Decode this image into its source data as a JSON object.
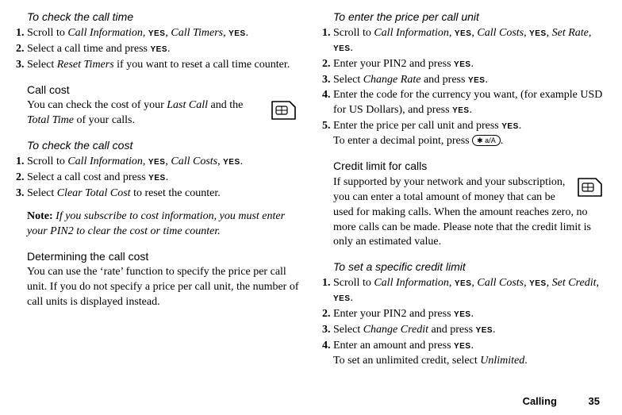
{
  "yes": "YES",
  "left": {
    "h_check_time": "To check the call time",
    "time_steps": [
      {
        "pre": "Scroll to ",
        "i1": "Call Information",
        "mid1": ", ",
        "y1": true,
        "mid2": ", ",
        "i2": "Call Timers",
        "mid3": ", ",
        "y2": true,
        "post": "."
      },
      {
        "text_a": "Select a call time and press ",
        "y": true,
        "text_b": "."
      },
      {
        "text_a": "Select ",
        "i": "Reset Timers",
        "text_b": " if you want to reset a call time counter."
      }
    ],
    "h_call_cost": "Call cost",
    "call_cost_p_a": "You can check the cost of your ",
    "call_cost_i1": "Last Call",
    "call_cost_p_b": " and the ",
    "call_cost_i2": "Total Time",
    "call_cost_p_c": " of your calls.",
    "h_check_cost": "To check the call cost",
    "cost_steps": [
      {
        "pre": "Scroll to ",
        "i1": "Call Information",
        "mid1": ", ",
        "y1": true,
        "mid2": ", ",
        "i2": "Call Costs",
        "mid3": ", ",
        "y2": true,
        "post": "."
      },
      {
        "text_a": "Select a call cost and press ",
        "y": true,
        "text_b": "."
      },
      {
        "text_a": "Select ",
        "i": "Clear Total Cost",
        "text_b": " to reset the counter."
      }
    ],
    "note_label": "Note:",
    "note_text": " If you subscribe to cost information, you must enter your PIN2 to clear the cost or time counter.",
    "h_determine": "Determining the call cost",
    "determine_p": "You can use the ‘rate’ function to specify the price per call unit. If you do not specify a price per call unit, the number of call units is displayed instead."
  },
  "right": {
    "h_enter_price": "To enter the price per call unit",
    "price_steps": [
      {
        "pre": "Scroll to ",
        "i1": "Call Information",
        "mid1": ", ",
        "y1": true,
        "mid2": ", ",
        "i2": "Call Costs",
        "mid3": ", ",
        "y2": true,
        "post": ", ",
        "i3": "Set Rate",
        "mid4": ", ",
        "y3": true,
        "post2": "."
      },
      {
        "text_a": "Enter your PIN2 and press ",
        "y": true,
        "text_b": "."
      },
      {
        "text_a": "Select ",
        "i": "Change Rate",
        "text_mid": " and press ",
        "y": true,
        "text_b": "."
      },
      {
        "text_a": "Enter the code for the currency you want, (for example USD for US Dollars), and press ",
        "y": true,
        "text_b": "."
      },
      {
        "text_a": "Enter the price per call unit and press ",
        "y": true,
        "text_b": ".",
        "line2_a": "To enter a decimal point, press ",
        "key": "✱ a/A",
        "line2_b": "."
      }
    ],
    "h_credit": "Credit limit for calls",
    "credit_p": "If supported by your network and your subscription, you can enter a total amount of money that can be used for making calls. When the amount reaches zero, no more calls can be made. Please note that the credit limit is only an estimated value.",
    "h_set_credit": "To set a specific credit limit",
    "credit_steps": [
      {
        "pre": "Scroll to ",
        "i1": "Call Information",
        "mid1": ", ",
        "y1": true,
        "mid2": ", ",
        "i2": "Call Costs",
        "mid3": ", ",
        "y2": true,
        "post": ", ",
        "i3": "Set Credit",
        "mid4": ", ",
        "y3": true,
        "post2": "."
      },
      {
        "text_a": "Enter your PIN2 and press ",
        "y": true,
        "text_b": "."
      },
      {
        "text_a": "Select ",
        "i": "Change Credit",
        "text_mid": " and press ",
        "y": true,
        "text_b": "."
      },
      {
        "text_a": "Enter an amount and press ",
        "y": true,
        "text_b": ".",
        "line2_a": "To set an unlimited credit, select ",
        "i2": "Unlimited",
        "line2_b": "."
      }
    ]
  },
  "footer": {
    "section": "Calling",
    "page": "35"
  }
}
